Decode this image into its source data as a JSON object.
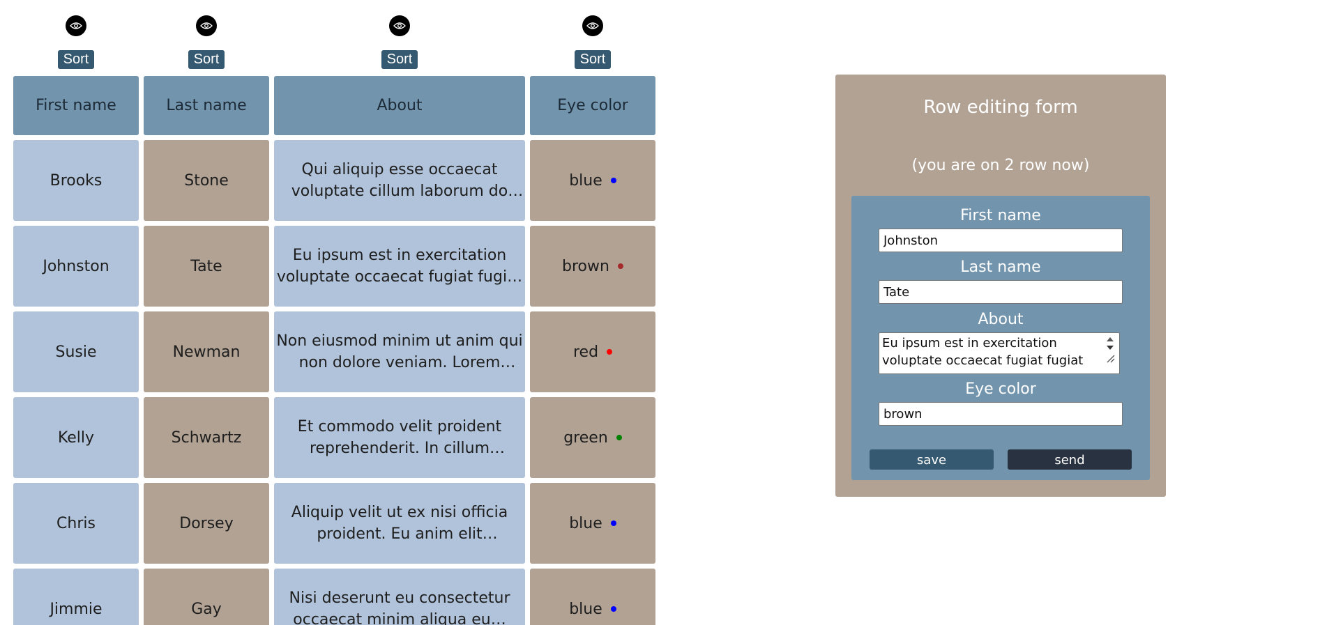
{
  "colors": {
    "header_cell": "#7294ad",
    "blue_cell": "#b0c3da",
    "tan_cell": "#b1a294",
    "sort_button": "#355970",
    "save_button": "#355970",
    "send_button": "#293241"
  },
  "table": {
    "controls": [
      {
        "icon": "eye-icon",
        "sort_label": "Sort"
      },
      {
        "icon": "eye-icon",
        "sort_label": "Sort"
      },
      {
        "icon": "eye-icon",
        "sort_label": "Sort"
      },
      {
        "icon": "eye-icon",
        "sort_label": "Sort"
      }
    ],
    "headers": [
      "First name",
      "Last name",
      "About",
      "Eye color"
    ],
    "rows": [
      {
        "first": "Brooks",
        "last": "Stone",
        "about": "Qui aliquip esse occaecat voluptate cillum laborum do adipisicing ea…",
        "eye": "blue",
        "eye_dot": "#0000ff"
      },
      {
        "first": "Johnston",
        "last": "Tate",
        "about": "Eu ipsum est in exercitation voluptate occaecat fugiat fugiat e…",
        "eye": "brown",
        "eye_dot": "#a52a2a"
      },
      {
        "first": "Susie",
        "last": "Newman",
        "about": "Non eiusmod minim ut anim qui non dolore veniam. Lorem venia…",
        "eye": "red",
        "eye_dot": "#ff0000"
      },
      {
        "first": "Kelly",
        "last": "Schwartz",
        "about": "Et commodo velit proident reprehenderit. In cillum adipisicin…",
        "eye": "green",
        "eye_dot": "#008000"
      },
      {
        "first": "Chris",
        "last": "Dorsey",
        "about": "Aliquip velit ut ex nisi officia proident. Eu anim elit deserunt…",
        "eye": "blue",
        "eye_dot": "#0000ff"
      },
      {
        "first": "Jimmie",
        "last": "Gay",
        "about": "Nisi deserunt eu consectetur occaecat minim aliqua eu…",
        "eye": "blue",
        "eye_dot": "#0000ff"
      }
    ]
  },
  "form": {
    "title": "Row editing form",
    "subtitle": "(you are on 2 row now)",
    "first_name_label": "First name",
    "first_name_value": "Johnston",
    "last_name_label": "Last name",
    "last_name_value": "Tate",
    "about_label": "About",
    "about_value": "Eu ipsum est in exercitation voluptate occaecat fugiat fugiat ea",
    "eye_color_label": "Eye color",
    "eye_color_value": "brown",
    "save_label": "save",
    "send_label": "send"
  }
}
